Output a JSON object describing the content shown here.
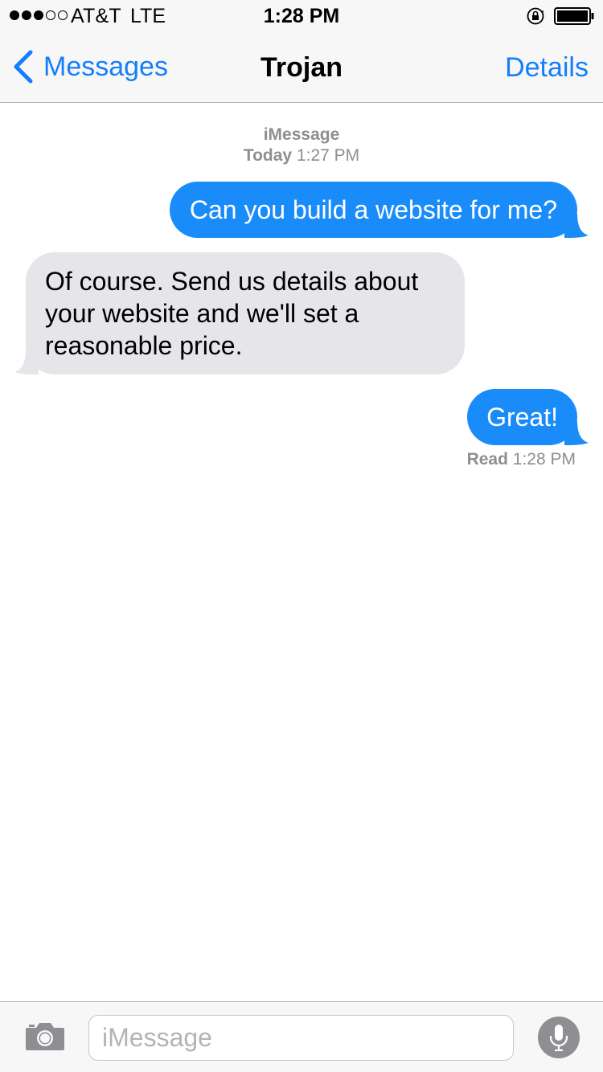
{
  "status_bar": {
    "signal_bars_filled": 3,
    "signal_bars_total": 5,
    "carrier": "AT&T",
    "network": "LTE",
    "time": "1:28 PM",
    "icons": [
      "orientation-lock-icon",
      "battery-icon"
    ]
  },
  "nav": {
    "back_label": "Messages",
    "title": "Trojan",
    "details_label": "Details"
  },
  "conversation": {
    "service": "iMessage",
    "date_label": "Today",
    "date_time": "1:27 PM",
    "messages": [
      {
        "direction": "sent",
        "text": "Can you build a website for me?"
      },
      {
        "direction": "received",
        "text": "Of course. Send us details about your website and we'll set a reasonable price."
      },
      {
        "direction": "sent",
        "text": "Great!"
      }
    ],
    "receipt_label": "Read",
    "receipt_time": "1:28 PM"
  },
  "input_bar": {
    "placeholder": "iMessage",
    "value": "",
    "icons": [
      "camera-icon",
      "microphone-icon"
    ]
  },
  "colors": {
    "accent": "#147efb",
    "sent_bubble": "#1a8cfa",
    "received_bubble": "#e5e5ea",
    "secondary_text": "#8e8e93"
  }
}
